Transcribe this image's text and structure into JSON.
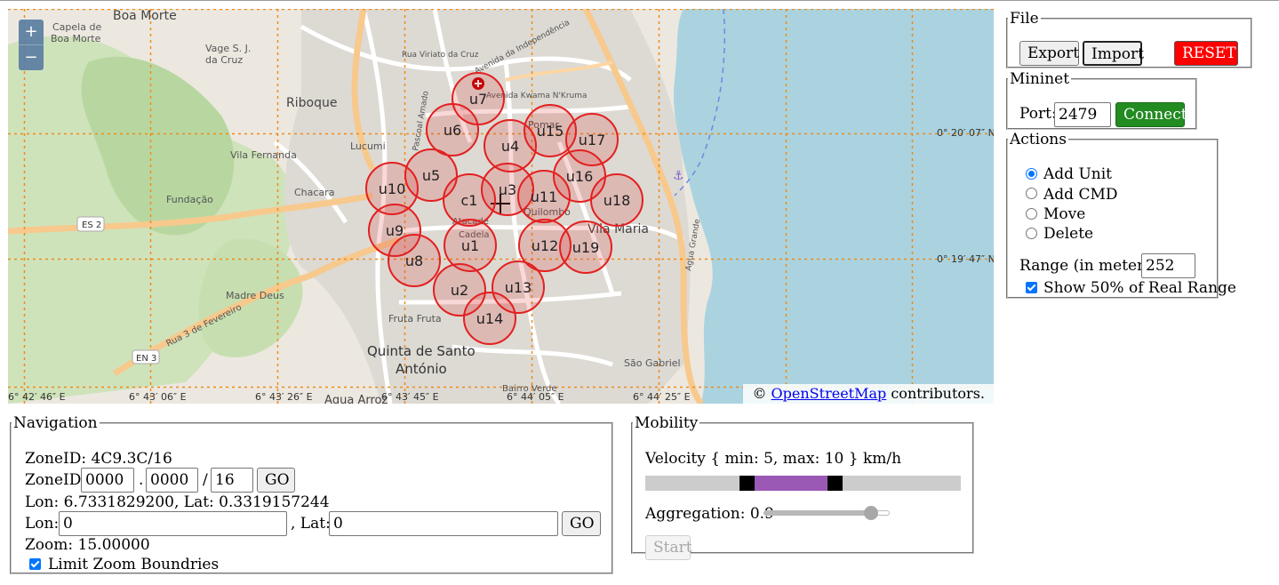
{
  "map": {
    "zoom_in_label": "+",
    "zoom_out_label": "−",
    "place_labels": [
      "Boa Morte",
      "Capela de",
      "Boa Morte",
      "Vage S. J.",
      "da Cruz",
      "Riboque",
      "Lucumi",
      "Vila Fernanda",
      "Chacara",
      "Fundação",
      "ES 2",
      "Madre Deus",
      "Rua 3 de Fevereiro",
      "EN 3",
      "Fruta Fruta",
      "Quinta de Santo",
      "António",
      "São Gabriel",
      "Vila Maria",
      "Pomar",
      "Atacade",
      "Quilombo",
      "Cadela",
      "Agua Arroz",
      "Bairro Verde",
      "Rua Viriato da Cruz",
      "Avenida da Independência",
      "Avenida Kwama N'Kruma",
      "Pascoal Amado",
      "Agua Grande"
    ],
    "lat_labels": [
      "0° 20′ 07″ N",
      "0° 19′ 47″ N"
    ],
    "lon_labels": [
      "6° 42′ 46″ E",
      "6° 43′ 06″ E",
      "6° 43′ 26″ E",
      "6° 43′ 45″ E",
      "6° 44′ 05″ E",
      "6° 44′ 25″ E"
    ],
    "units": [
      "u7",
      "u6",
      "u15",
      "u17",
      "u4",
      "u5",
      "u16",
      "u10",
      "u3",
      "c1",
      "u11",
      "u18",
      "u9",
      "u1",
      "u12",
      "u19",
      "u8",
      "u13",
      "u2",
      "u14"
    ],
    "attribution_prefix": "©",
    "attribution_link": "OpenStreetMap",
    "attribution_suffix": "contributors."
  },
  "file": {
    "legend": "File",
    "export_label": "Export",
    "import_label": "Import",
    "reset_label": "RESET",
    "reset_color": "#ff0000"
  },
  "mininet": {
    "legend": "Mininet",
    "port_label": "Port:",
    "port_value": "2479",
    "connect_label": "Connect",
    "connect_color": "#228b22"
  },
  "actions": {
    "legend": "Actions",
    "options": [
      "Add Unit",
      "Add CMD",
      "Move",
      "Delete"
    ],
    "selected": "Add Unit",
    "range_label": "Range (in meters):",
    "range_value": "252",
    "show_half_label": "Show 50% of Real Range",
    "show_half_checked": true
  },
  "navigation": {
    "legend": "Navigation",
    "zoneid_text": "ZoneID: 4C9.3C/16",
    "zoneid_label": "ZoneID:",
    "zone_a": "0000",
    "zone_sep": ".",
    "zone_b": "0000",
    "zone_slash": "/",
    "zone_level": "16",
    "go_label": "GO",
    "lonlat_text": "Lon: 6.7331829200, Lat: 0.3319157244",
    "lon_label": "Lon:",
    "lon_value": "0",
    "lat_label": ", Lat:",
    "lat_value": "0",
    "zoom_text": "Zoom: 15.00000",
    "limit_zoom_label": "Limit Zoom Boundries",
    "limit_zoom_checked": true
  },
  "mobility": {
    "legend": "Mobility",
    "velocity_text": "Velocity { min: 5, max: 10 } km/h",
    "velocity_min_fraction": 0.3,
    "velocity_max_fraction": 0.58,
    "aggregation_text": "Aggregation: 0.9",
    "aggregation_value": 0.9,
    "start_label": "Start"
  },
  "colors": {
    "range_circle": "#e32020",
    "range_fill": "rgba(220,40,40,0.18)",
    "grid": "#f08a18",
    "sea": "#aad3df",
    "velocity_range": "#9b59b6"
  }
}
